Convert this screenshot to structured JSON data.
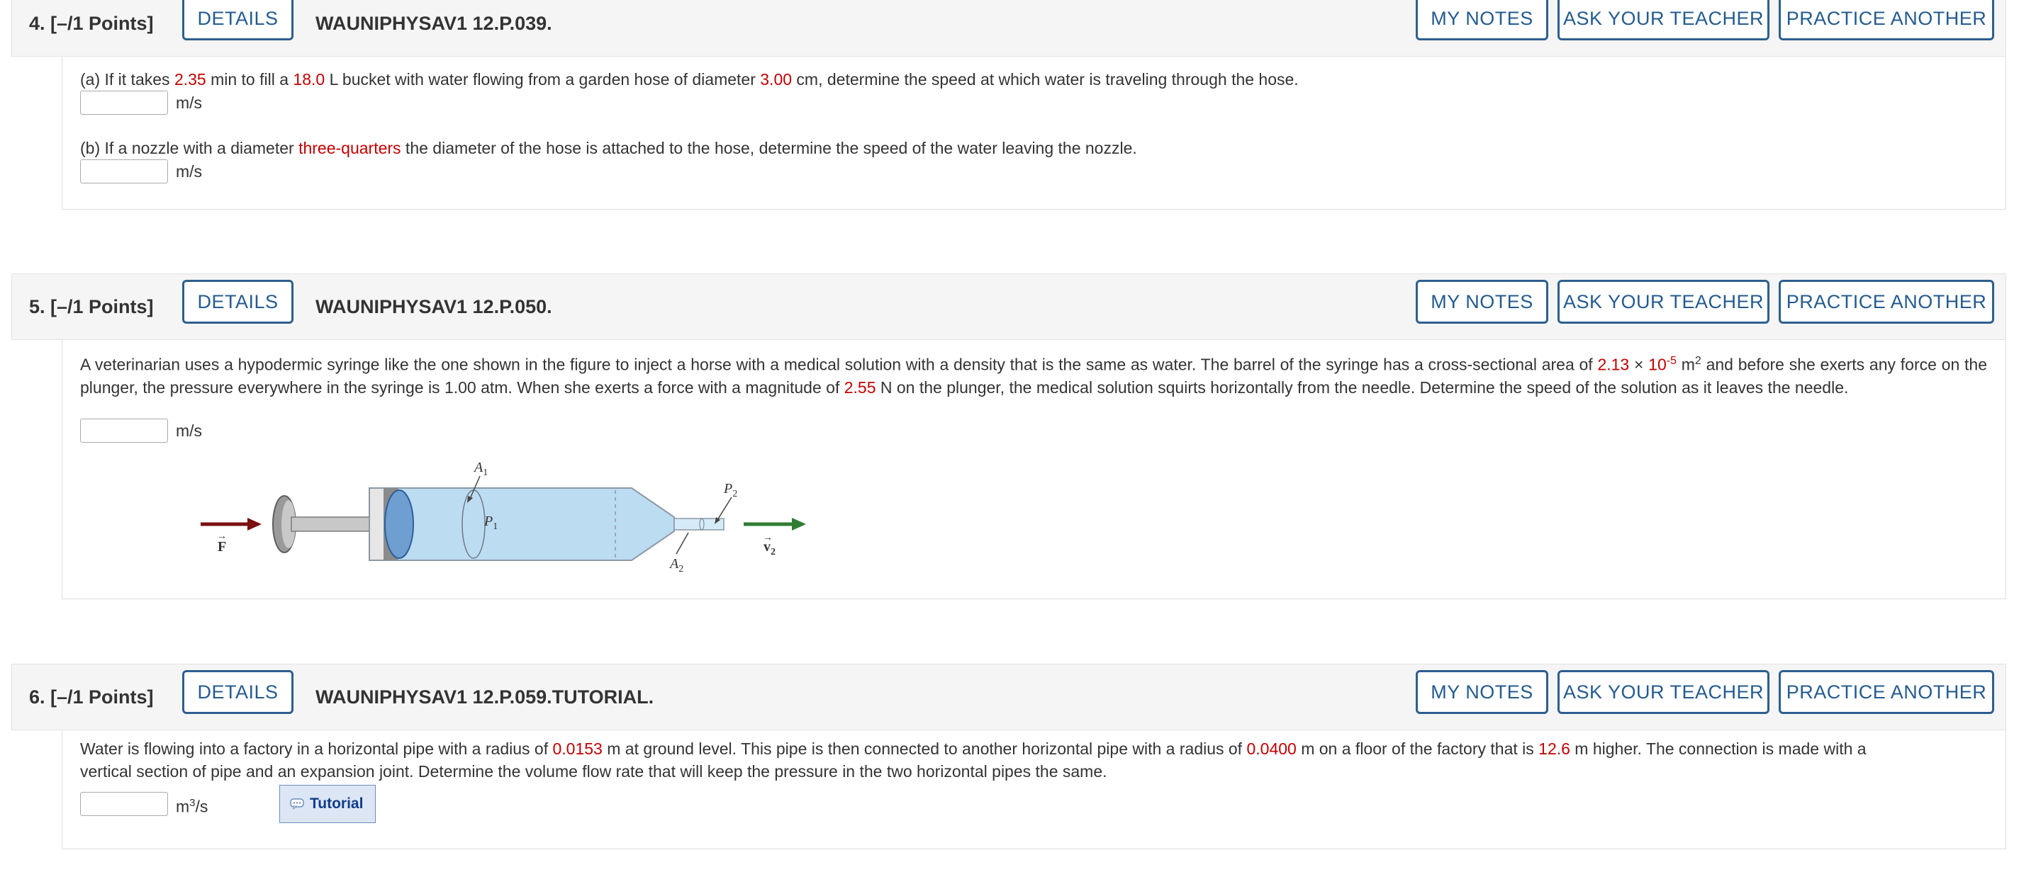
{
  "common": {
    "details": "DETAILS",
    "my_notes": "MY NOTES",
    "ask_teacher": "ASK YOUR TEACHER",
    "practice": "PRACTICE ANOTHER"
  },
  "q4": {
    "number": "4.  [–/1 Points]",
    "code": "WAUNIPHYSAV1 12.P.039.",
    "a": {
      "p1": "(a) If it takes ",
      "v1": "2.35",
      "p2": " min to fill a ",
      "v2": "18.0",
      "p3": " L bucket with water flowing from a garden hose of diameter ",
      "v3": "3.00",
      "p4": " cm, determine the speed at which water is traveling through the hose.",
      "unit": "m/s"
    },
    "b": {
      "p1": "(b) If a nozzle with a diameter ",
      "v1": "three-quarters",
      "p2": " the diameter of the hose is attached to the hose, determine the speed of the water leaving the nozzle.",
      "unit": "m/s"
    }
  },
  "q5": {
    "number": "5.  [–/1 Points]",
    "code": "WAUNIPHYSAV1 12.P.050.",
    "t1": "A veterinarian uses a hypodermic syringe like the one shown in the figure to inject a horse with a medical solution with a density that is the same as water. The barrel of the syringe has a cross-sectional area of ",
    "area_val": "2.13",
    "times": " × ",
    "ten": "10",
    "exp": "-5",
    "t2": " m",
    "sq": "2",
    "t3": " and before she exerts any force on the plunger, the pressure everywhere in the syringe is 1.00 atm. When she exerts a force with a magnitude of ",
    "force_val": "2.55",
    "t4": " N on the plunger, the medical solution squirts horizontally from the needle. Determine the speed of the solution as it leaves the needle.",
    "unit": "m/s",
    "figure": {
      "a1": "A",
      "a1_sub": "1",
      "a2": "A",
      "a2_sub": "2",
      "p1": "P",
      "p1_sub": "1",
      "p2": "P",
      "p2_sub": "2",
      "f": "F",
      "v2": "v",
      "v2_sub": "2",
      "colors": {
        "force_arrow": "#7a1010",
        "velocity_arrow": "#2e7d32",
        "liquid": "#bcdcf2"
      }
    }
  },
  "q6": {
    "number": "6.  [–/1 Points]",
    "code": "WAUNIPHYSAV1 12.P.059.TUTORIAL.",
    "t1": "Water is flowing into a factory in a horizontal pipe with a radius of ",
    "v1": "0.0153",
    "t2": " m at ground level. This pipe is then connected to another horizontal pipe with a radius of ",
    "v2": "0.0400",
    "t3": " m on a floor of the factory that is ",
    "v3": "12.6",
    "t4": " m higher. The connection is made with a",
    "line2": "vertical section of pipe and an expansion joint. Determine the volume flow rate that will keep the pressure in the two horizontal pipes the same.",
    "unit_m": "m",
    "unit_exp": "3",
    "unit_s": "/s",
    "tutorial": "Tutorial",
    "tutorial_icon": "tutorial-icon"
  }
}
